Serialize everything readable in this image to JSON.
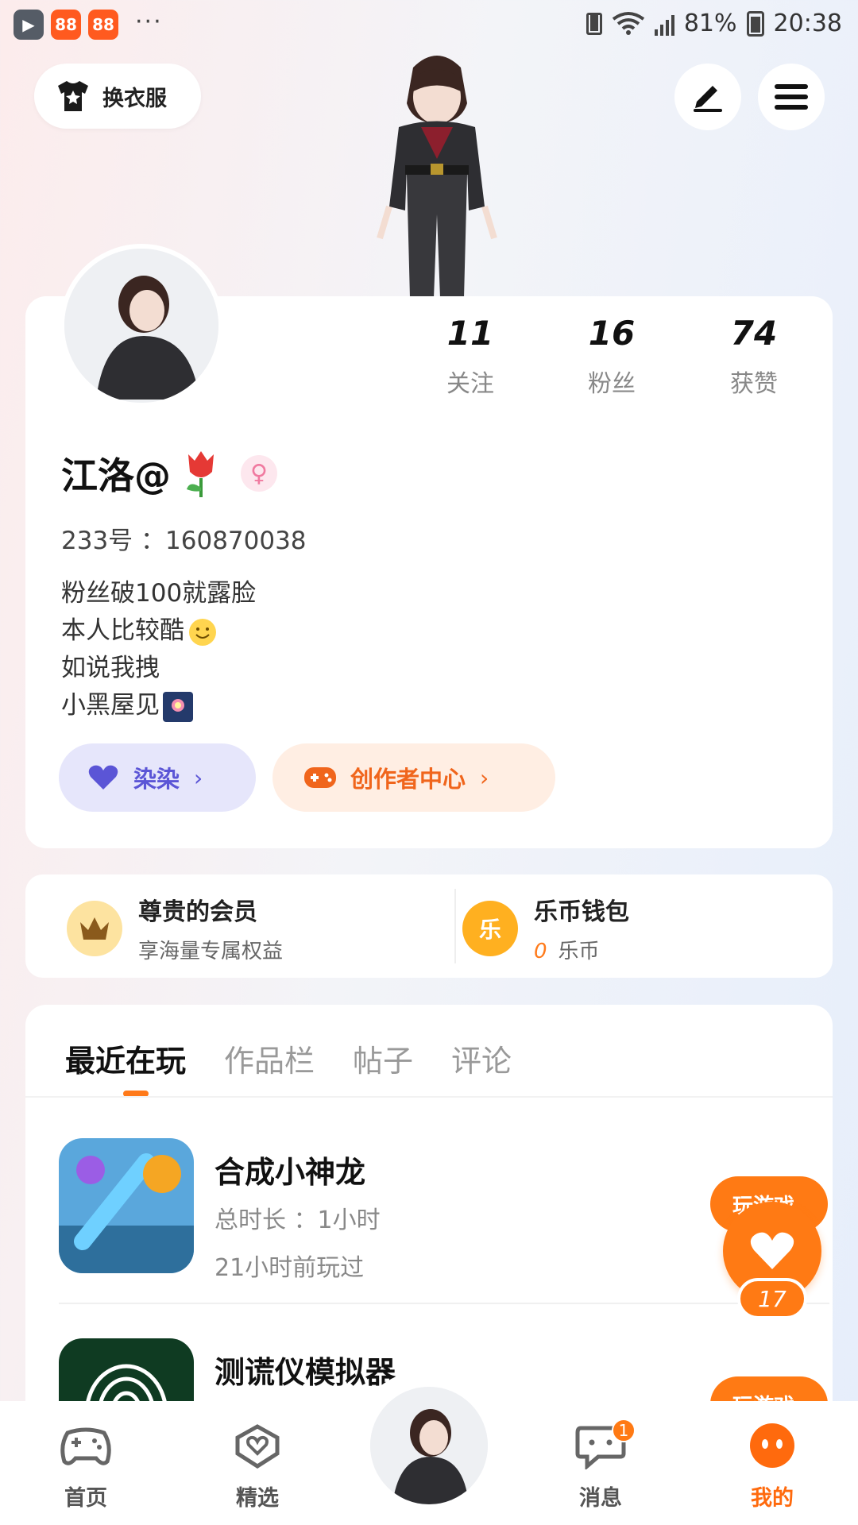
{
  "status_bar": {
    "battery": "81%",
    "time": "20:38",
    "more": "···"
  },
  "header": {
    "outfit_label": "换衣服"
  },
  "profile": {
    "stats": [
      {
        "value": "11",
        "label": "关注"
      },
      {
        "value": "16",
        "label": "粉丝"
      },
      {
        "value": "74",
        "label": "获赞"
      }
    ],
    "name": "江洛@",
    "id_line": "233号 ：160870038",
    "bio": [
      "粉丝破100就露脸",
      "本人比较酷",
      "如说我拽",
      "小黑屋见"
    ],
    "buttons": {
      "purple": "染染",
      "orange": "创作者中心"
    }
  },
  "member": {
    "vip_title": "尊贵的会员",
    "vip_sub": "享海量专属权益",
    "wallet_icon": "乐",
    "wallet_title": "乐币钱包",
    "wallet_amount": "0",
    "wallet_unit": "乐币"
  },
  "tabs": [
    "最近在玩",
    "作品栏",
    "帖子",
    "评论"
  ],
  "games": [
    {
      "name": "合成小神龙",
      "duration": "总时长 ：1小时",
      "last_played": "21小时前玩过",
      "button": "玩游戏"
    },
    {
      "name": "测谎仪模拟器",
      "duration": "",
      "last_played": "",
      "button": "玩游戏"
    }
  ],
  "like_count": "17",
  "bottom_nav": [
    {
      "label": "首页"
    },
    {
      "label": "精选"
    },
    {
      "label": "消息",
      "badge": "1"
    },
    {
      "label": "我的"
    }
  ],
  "colors": {
    "accent": "#ff7a14",
    "purple": "#5b55d6",
    "background": "#f3f4f8"
  }
}
